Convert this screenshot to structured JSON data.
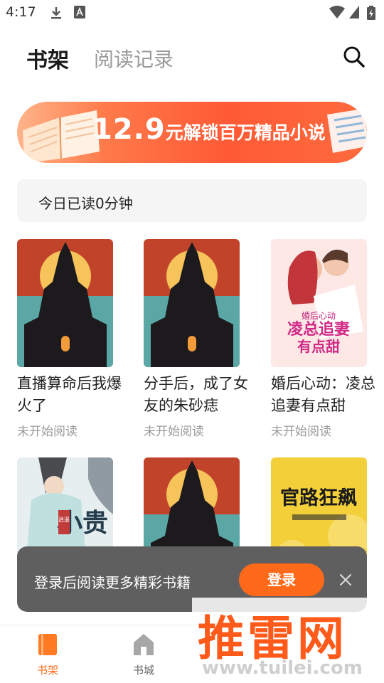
{
  "status_bar": {
    "time": "4:17"
  },
  "header": {
    "tabs": [
      {
        "label": "书架",
        "active": true
      },
      {
        "label": "阅读记录",
        "active": false
      }
    ]
  },
  "banner": {
    "price": "12.9",
    "text": "元解锁百万精品小说"
  },
  "reading_stats": {
    "text": "今日已读0分钟"
  },
  "books": [
    {
      "title": "直播算命后我爆火了",
      "status": "未开始阅读",
      "cover": "dark-castle"
    },
    {
      "title": "分手后，成了女友的朱砂痣",
      "status": "未开始阅读",
      "cover": "dark-castle"
    },
    {
      "title": "婚后心动：凌总追妻有点甜",
      "status": "未开始阅读",
      "cover": "romance",
      "cover_title_line1": "婚后心动",
      "cover_title_line2": "凌总追妻",
      "cover_title_line3": "有点甜"
    },
    {
      "title": "",
      "status": "",
      "cover": "wuxia",
      "cover_title": "小贵",
      "cover_tag": "逍遥"
    },
    {
      "title": "",
      "status": "",
      "cover": "dark-castle"
    },
    {
      "title": "",
      "status": "",
      "cover": "official",
      "cover_title": "官路狂飙"
    }
  ],
  "login_toast": {
    "text": "登录后阅读更多精彩书籍",
    "button": "登录"
  },
  "bottom_nav": [
    {
      "label": "书架",
      "icon": "bookshelf-icon",
      "active": true
    },
    {
      "label": "书城",
      "icon": "bookstore-icon",
      "active": false
    }
  ],
  "watermark": {
    "main": "推雷网",
    "url": "www.tuilei.com"
  },
  "colors": {
    "accent": "#ff6a1a",
    "inactive": "#9a9a9a",
    "toast_bg": "#5f5f5f"
  }
}
